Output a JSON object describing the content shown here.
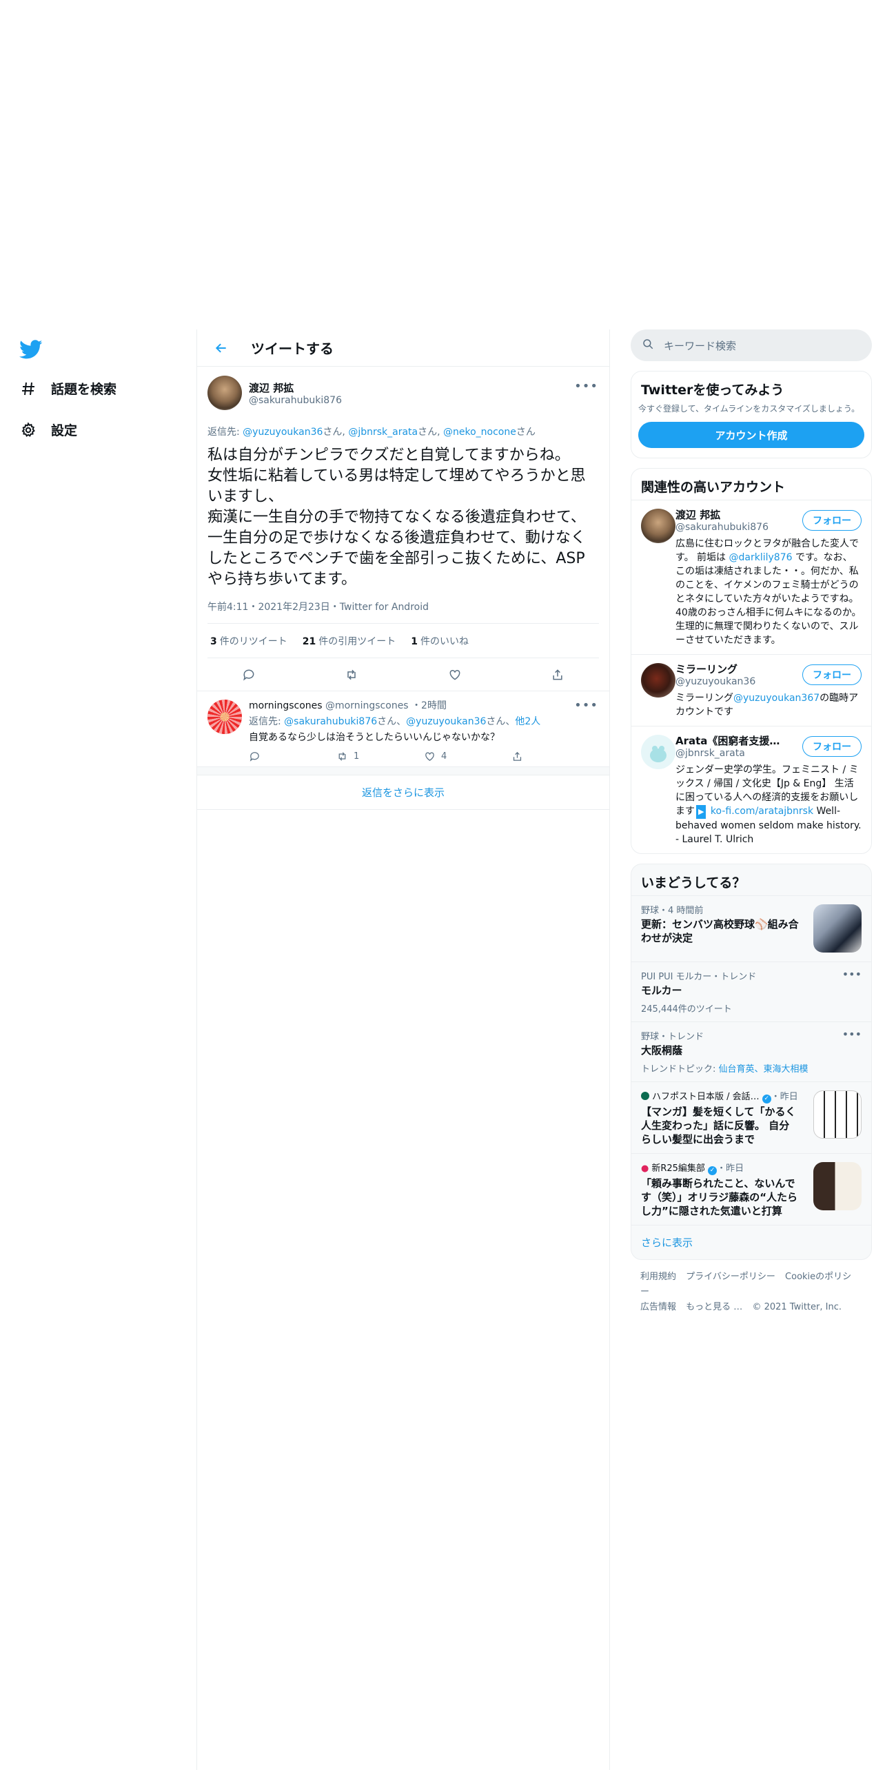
{
  "nav": {
    "items": [
      {
        "label": "話題を検索",
        "icon": "hashtag-icon"
      },
      {
        "label": "設定",
        "icon": "gear-icon"
      }
    ]
  },
  "header": {
    "title": "ツイートする"
  },
  "tweet": {
    "display_name": "渡辺 邦拡",
    "handle": "@sakurahubuki876",
    "reply_prefix": "返信先:",
    "reply_to": [
      "@yuzuyoukan36",
      "@jbnrsk_arata",
      "@neko_nocone"
    ],
    "reply_suffix": "さん",
    "text": "私は自分がチンピラでクズだと自覚してますからね。\n女性垢に粘着している男は特定して埋めてやろうかと思いますし、\n痴漢に一生自分の手で物持てなくなる後遺症負わせて、一生自分の足で歩けなくなる後遺症負わせて、動けなくしたところでペンチで歯を全部引っこ抜くために、ASPやら持ち歩いてます。",
    "meta": "午前4:11・2021年2月23日・Twitter for Android",
    "retweets_count": "3",
    "retweets_label": "件のリツイート",
    "quotes_count": "21",
    "quotes_label": "件の引用ツイート",
    "likes_count": "1",
    "likes_label": "件のいいね"
  },
  "reply": {
    "display_name": "morningscones",
    "handle": "@morningscones",
    "time": "・2時間",
    "reply_prefix": "返信先:",
    "reply_to_1": "@sakurahubuki876",
    "reply_to_2": "@yuzuyoukan36",
    "reply_others": "他2人",
    "san": "さん、",
    "text": "自覚あるなら少しは治そうとしたらいいんじゃないかな？",
    "retweets": "1",
    "likes": "4"
  },
  "show_more_replies": "返信をさらに表示",
  "search": {
    "placeholder": "キーワード検索"
  },
  "signup": {
    "title": "Twitterを使ってみよう",
    "subtitle": "今すぐ登録して、タイムラインをカスタマイズしましょう。",
    "button": "アカウント作成"
  },
  "related": {
    "title": "関連性の高いアカウント",
    "follow_label": "フォロー",
    "accounts": [
      {
        "name": "渡辺 邦拡",
        "handle": "@sakurahubuki876",
        "bio_1": "広島に住むロックとヲタが融合した変人です。 前垢は ",
        "bio_link": "@darklily876",
        "bio_2": " です。なお、この垢は凍結されました・・。何だか、私のことを、イケメンのフェミ騎士がどうのとネタにしていた方々がいたようですね。 40歳のおっさん相手に何ムキになるのか。 生理的に無理で関わりたくないので、スルーさせていただきます。"
      },
      {
        "name": "ミラーリング",
        "handle": "@yuzuyoukan36",
        "bio_1": "ミラーリング",
        "bio_link": "@yuzuyoukan367",
        "bio_2": "の臨時アカウントです"
      },
      {
        "name": "Arata《困窮者支援の…",
        "handle": "@jbnrsk_arata",
        "bio_1": "ジェンダー史学の学生。フェミニスト / ミックス / 帰国 / 文化史【Jp & Eng】 生活に困っている人への経済的支援をお願いします",
        "bio_icon": "▶",
        "bio_link": " ko-fi.com/aratajbnrsk",
        "bio_2": " Well-behaved women seldom make history. - Laurel T. Ulrich"
      }
    ]
  },
  "trends": {
    "title": "いまどうしてる？",
    "items": [
      {
        "context": "野球・4 時間前",
        "title": "更新：センバツ高校野球⚾組み合わせが決定",
        "sub": ""
      },
      {
        "context": "PUI PUI モルカー・トレンド",
        "title": "モルカー",
        "sub": "245,444件のツイート"
      },
      {
        "context": "野球・トレンド",
        "title": "大阪桐蔭",
        "sub_prefix": "トレンドトピック: ",
        "sub_links": "仙台育英、東海大相模"
      },
      {
        "context": "ハフポスト日本版 / 会話…",
        "context_suffix": "・昨日",
        "title": "【マンガ】髪を短くして「かるく人生変わった」話に反響。 自分らしい髪型に出会うまで"
      },
      {
        "context": "新R25編集部",
        "context_suffix": "・昨日",
        "title": "「頼み事断られたこと、ないんです（笑）」オリラジ藤森の“人たらし力”に隠された気遣いと打算"
      }
    ],
    "show_more": "さらに表示"
  },
  "footer": {
    "links": [
      "利用規約",
      "プライバシーポリシー",
      "Cookieのポリシー",
      "広告情報",
      "もっと見る …"
    ],
    "copyright": "© 2021 Twitter, Inc."
  },
  "colors": {
    "accent": "#1da1f2",
    "link": "#1b95e0",
    "muted": "#5b7083"
  }
}
